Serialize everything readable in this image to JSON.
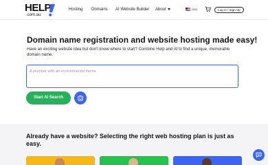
{
  "header": {
    "logo_main": "HELP",
    "logo_sub": ".com.au",
    "nav": {
      "hosting": "Hosting",
      "domains": "Domains",
      "ai_builder": "AI Website Builder",
      "about": "About"
    },
    "currency": "USD",
    "login_label": "Log in / Sign Up"
  },
  "hero": {
    "title": "Domain name registration and website hosting made easy!",
    "subtitle": "Have an exciting website idea but don't know where to start? Combine Help and AI to find a unique, memorable domain name.",
    "search_placeholder": "A plumber with an environmental theme",
    "start_button": "Start AI Search"
  },
  "plans": {
    "title": "Already have a website? Selecting the right web hosting plan is just as easy."
  },
  "colors": {
    "accent_green": "#25b25a",
    "accent_blue": "#3b66f5",
    "card_yellow": "#f6b817",
    "card_green": "#26c24e",
    "card_blue": "#3b66f5"
  },
  "icons": {
    "ai": "ai-sparkle-icon",
    "cart": "cart-icon",
    "flag": "us-flag-icon",
    "chat": "chat-icon"
  }
}
